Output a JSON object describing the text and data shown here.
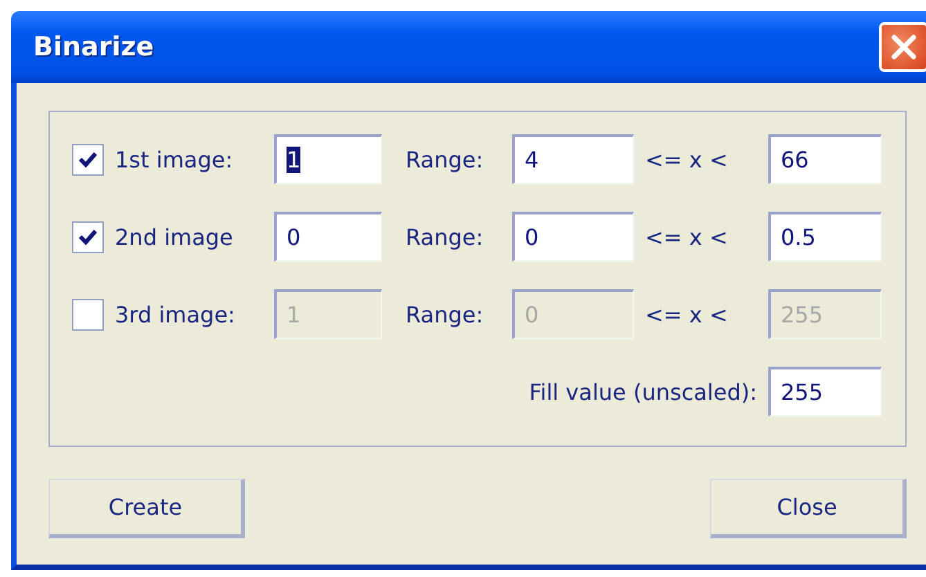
{
  "window": {
    "title": "Binarize"
  },
  "rows": [
    {
      "checked": true,
      "disabled": false,
      "label": "1st image:",
      "image_value": "1",
      "value_selected": true,
      "range_label": "Range:",
      "range_from": "4",
      "operator": "<= x <",
      "range_to": "66"
    },
    {
      "checked": true,
      "disabled": false,
      "label": "2nd image",
      "image_value": "0",
      "value_selected": false,
      "range_label": "Range:",
      "range_from": "0",
      "operator": "<= x <",
      "range_to": "0.5"
    },
    {
      "checked": false,
      "disabled": true,
      "label": "3rd image:",
      "image_value": "1",
      "value_selected": false,
      "range_label": "Range:",
      "range_from": "0",
      "operator": "<= x <",
      "range_to": "255"
    }
  ],
  "fill": {
    "label": "Fill value (unscaled):",
    "value": "255"
  },
  "buttons": [
    {
      "label": "Create"
    },
    {
      "label": "Close"
    }
  ]
}
